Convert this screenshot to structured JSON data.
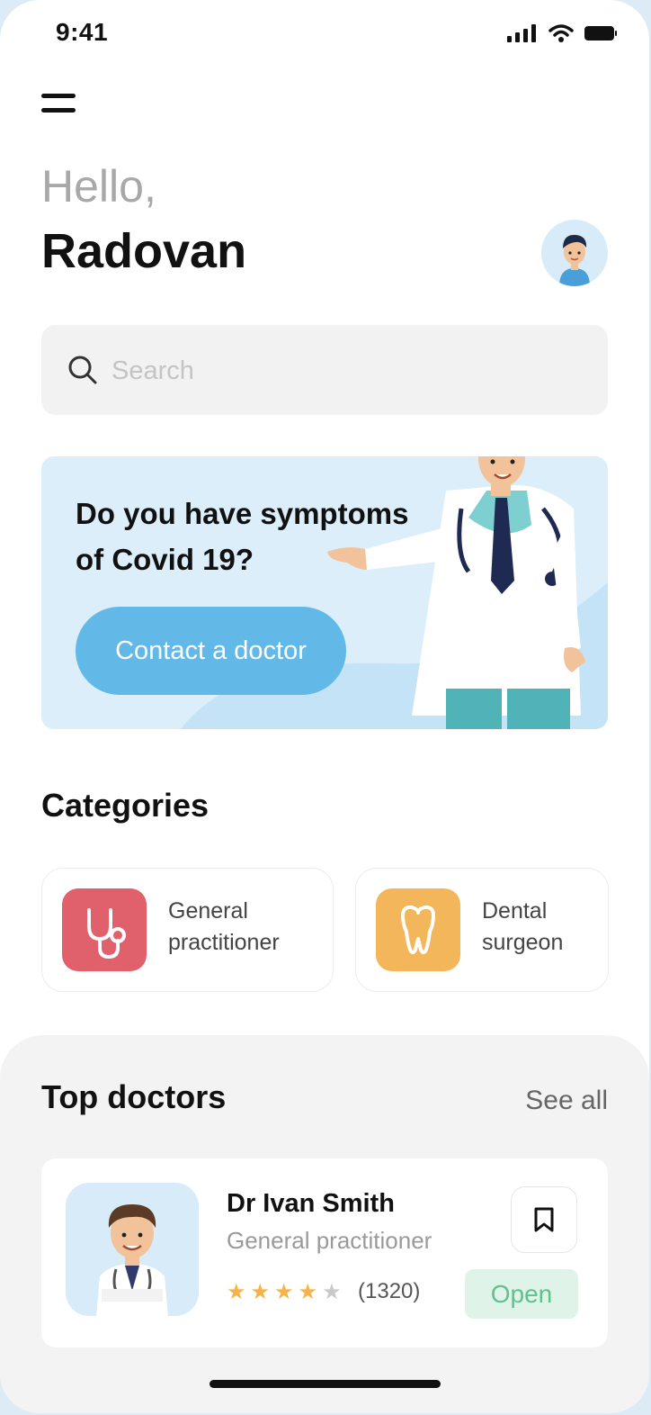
{
  "status_bar": {
    "time": "9:41"
  },
  "greeting": {
    "hello": "Hello,",
    "name": "Radovan"
  },
  "search": {
    "placeholder": "Search"
  },
  "banner": {
    "title": "Do you have symptoms of Covid 19?",
    "button_label": "Contact a doctor"
  },
  "categories": {
    "title": "Categories",
    "items": [
      {
        "label": "General practitioner",
        "icon": "stethoscope-icon",
        "color": "#e0616b"
      },
      {
        "label": "Dental surgeon",
        "icon": "tooth-icon",
        "color": "#f3b65b"
      }
    ]
  },
  "top_doctors": {
    "title": "Top doctors",
    "see_all": "See all",
    "doctors": [
      {
        "name": "Dr Ivan Smith",
        "specialty": "General practitioner",
        "rating": 4,
        "rating_max": 5,
        "reviews": "(1320)",
        "status": "Open"
      }
    ]
  },
  "colors": {
    "accent": "#62b9e8",
    "banner_bg": "#dbeef9",
    "open_green": "#5fc28e",
    "star": "#f5b349"
  }
}
